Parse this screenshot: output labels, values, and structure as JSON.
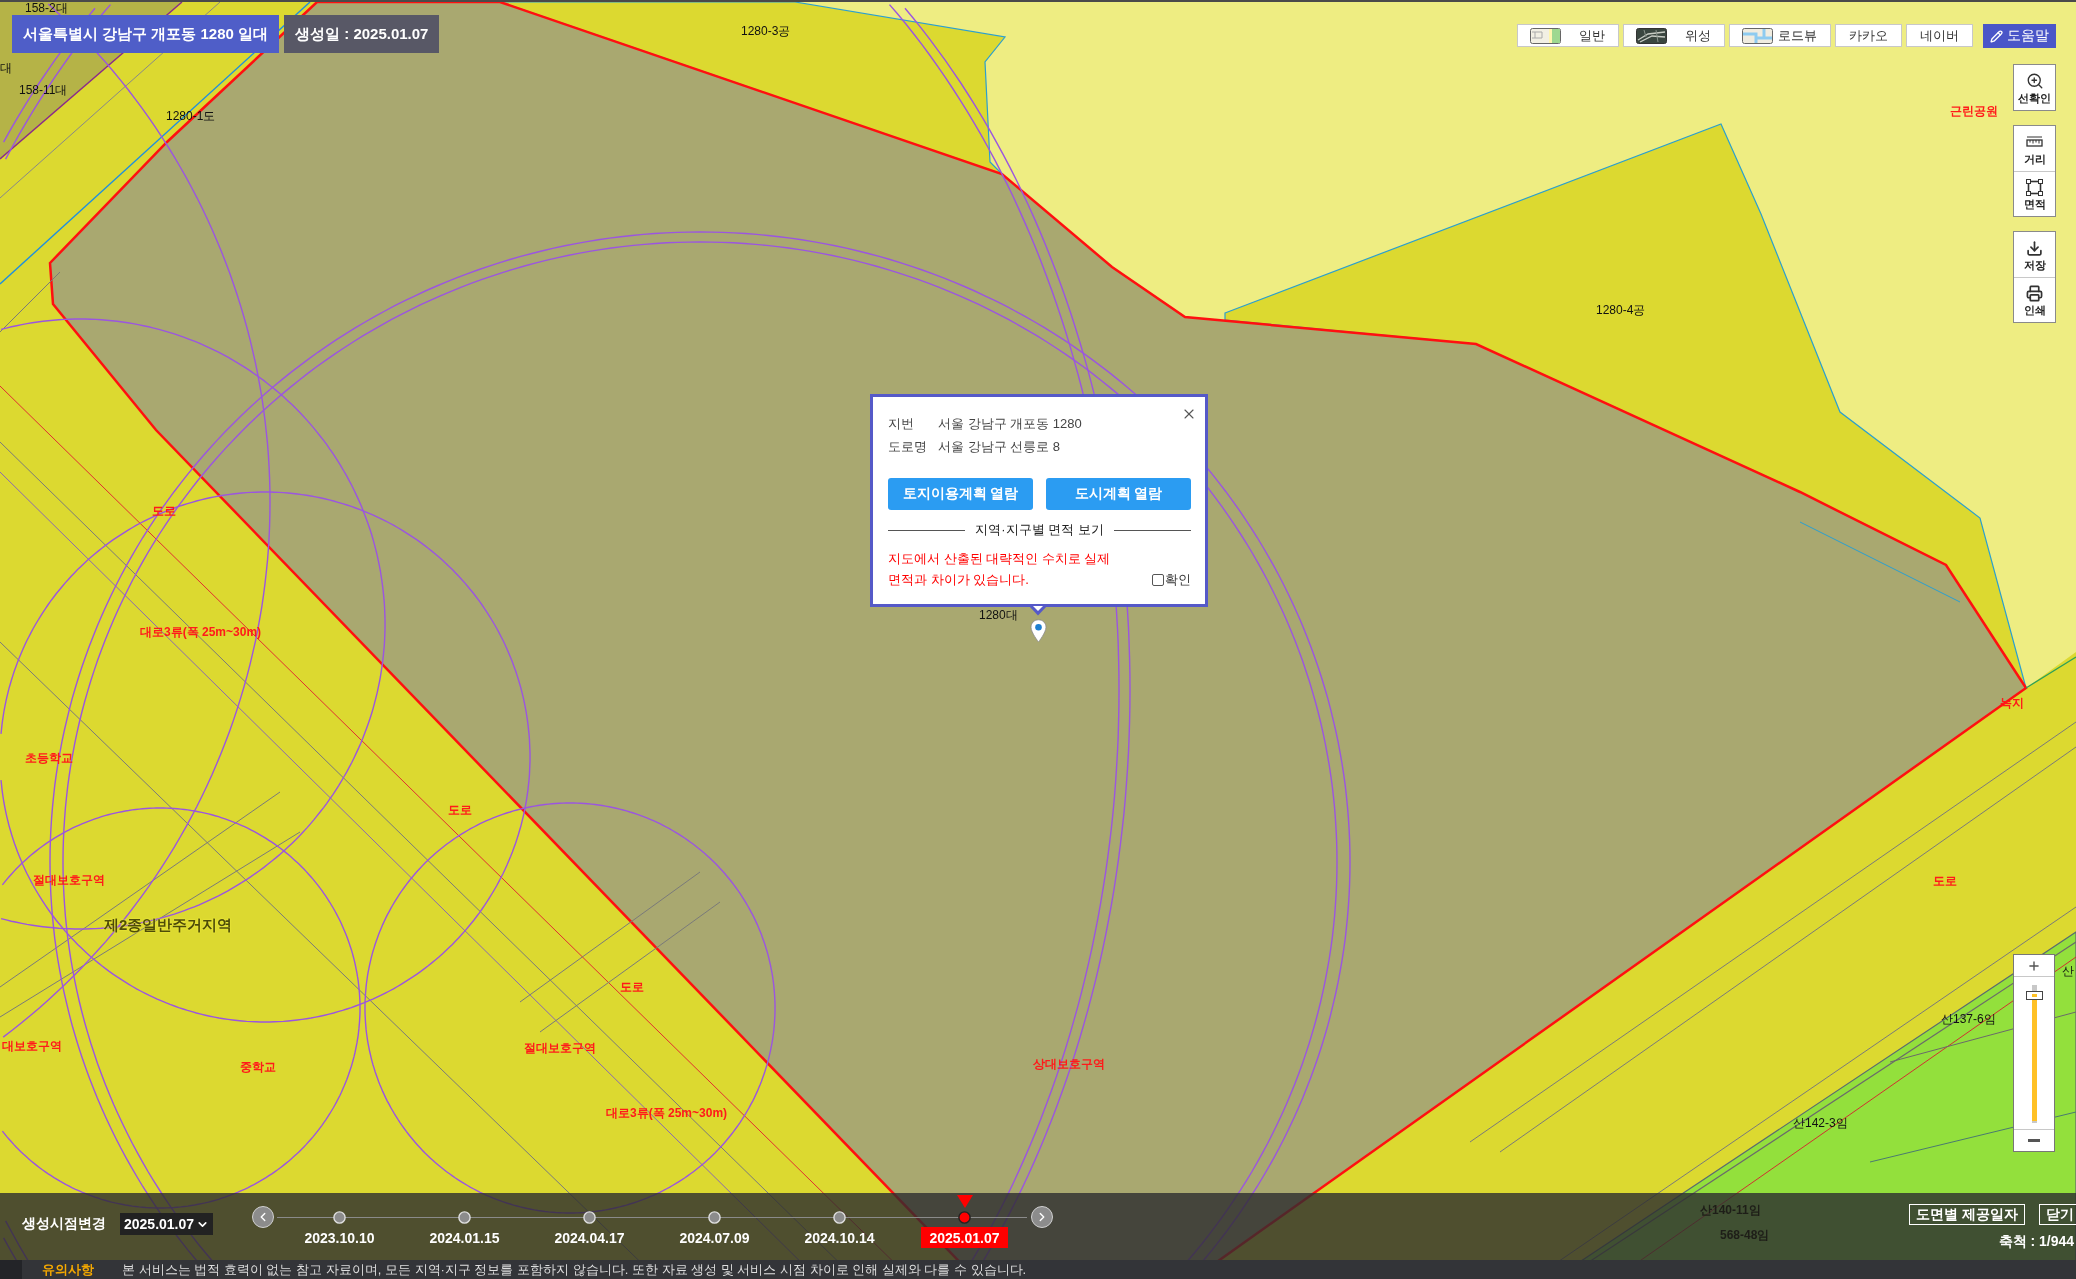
{
  "header": {
    "location": "서울특별시 강남구 개포동 1280 일대",
    "created": "생성일 : 2025.01.07"
  },
  "map_types": [
    {
      "label": "일반",
      "kind": "map"
    },
    {
      "label": "위성",
      "kind": "satellite"
    },
    {
      "label": "로드뷰",
      "kind": "road"
    },
    {
      "label": "카카오",
      "kind": "plain"
    },
    {
      "label": "네이버",
      "kind": "plain"
    }
  ],
  "help_button": {
    "label": "도움말"
  },
  "tool_groups": [
    [
      {
        "label": "선확인"
      }
    ],
    [
      {
        "label": "거리"
      },
      {
        "label": "면적"
      }
    ],
    [
      {
        "label": "저장"
      },
      {
        "label": "인쇄"
      }
    ]
  ],
  "map_labels": [
    {
      "text": "158-2대",
      "kind": "lot"
    },
    {
      "text": "대",
      "kind": "lot"
    },
    {
      "text": "158-11대",
      "kind": "lot"
    },
    {
      "text": "1280-1도",
      "kind": "lot"
    },
    {
      "text": "1280-3공",
      "kind": "lot"
    },
    {
      "text": "근린공원",
      "kind": "zone"
    },
    {
      "text": "1280-4공",
      "kind": "lot"
    },
    {
      "text": "도로",
      "kind": "zone"
    },
    {
      "text": "대로3류(폭 25m~30m)",
      "kind": "zone"
    },
    {
      "text": "초등학교",
      "kind": "zone"
    },
    {
      "text": "도로",
      "kind": "zone"
    },
    {
      "text": "절대보호구역",
      "kind": "zone"
    },
    {
      "text": "제2종일반주거지역",
      "kind": "district"
    },
    {
      "text": "대보호구역",
      "kind": "zone"
    },
    {
      "text": "중학교",
      "kind": "zone"
    },
    {
      "text": "도로",
      "kind": "zone"
    },
    {
      "text": "절대보호구역",
      "kind": "zone"
    },
    {
      "text": "대로3류(폭 25m~30m)",
      "kind": "zone"
    },
    {
      "text": "상대보호구역",
      "kind": "zone"
    },
    {
      "text": "1280대",
      "kind": "lot"
    },
    {
      "text": "녹지",
      "kind": "zone"
    },
    {
      "text": "도로",
      "kind": "zone"
    },
    {
      "text": "산137-6임",
      "kind": "lot"
    },
    {
      "text": "산142-3임",
      "kind": "lot"
    },
    {
      "text": "산",
      "kind": "lot"
    },
    {
      "text": "산140-11임",
      "kind": "shaded"
    },
    {
      "text": "568-48임",
      "kind": "shaded"
    }
  ],
  "popup": {
    "rows": [
      {
        "label": "지번",
        "value": "서울 강남구 개포동 1280"
      },
      {
        "label": "도로명",
        "value": "서울 강남구 선릉로 8"
      }
    ],
    "buttons": [
      "토지이용계획 열람",
      "도시계획 열람"
    ],
    "section_title": "지역·지구별 면적 보기",
    "warning": "지도에서 산출된 대략적인 수치로 실제 면적과 차이가 있습니다.",
    "confirm": {
      "label": "확인",
      "checked": false
    }
  },
  "zoom_slider": {
    "level": 0.93
  },
  "timeline": {
    "label": "생성시점변경",
    "select": {
      "value": "2025.01.07"
    },
    "dates": [
      {
        "label": "2023.10.10",
        "selected": false
      },
      {
        "label": "2024.01.15",
        "selected": false
      },
      {
        "label": "2024.04.17",
        "selected": false
      },
      {
        "label": "2024.07.09",
        "selected": false
      },
      {
        "label": "2024.10.14",
        "selected": false
      },
      {
        "label": "2025.01.07",
        "selected": true
      }
    ]
  },
  "bottom_right": {
    "sheet_dates_button": "도면별 제공일자",
    "close_button": "닫기",
    "scale": "축척 : 1/944"
  },
  "notice": {
    "title": "유의사항",
    "text": "본 서비스는 법적 효력이 없는 참고 자료이며, 모든 지역·지구 정보를 포함하지 않습니다. 또한 자료 생성 및 서비스 시점 차이로 인해 실제와 다를 수 있습니다."
  }
}
